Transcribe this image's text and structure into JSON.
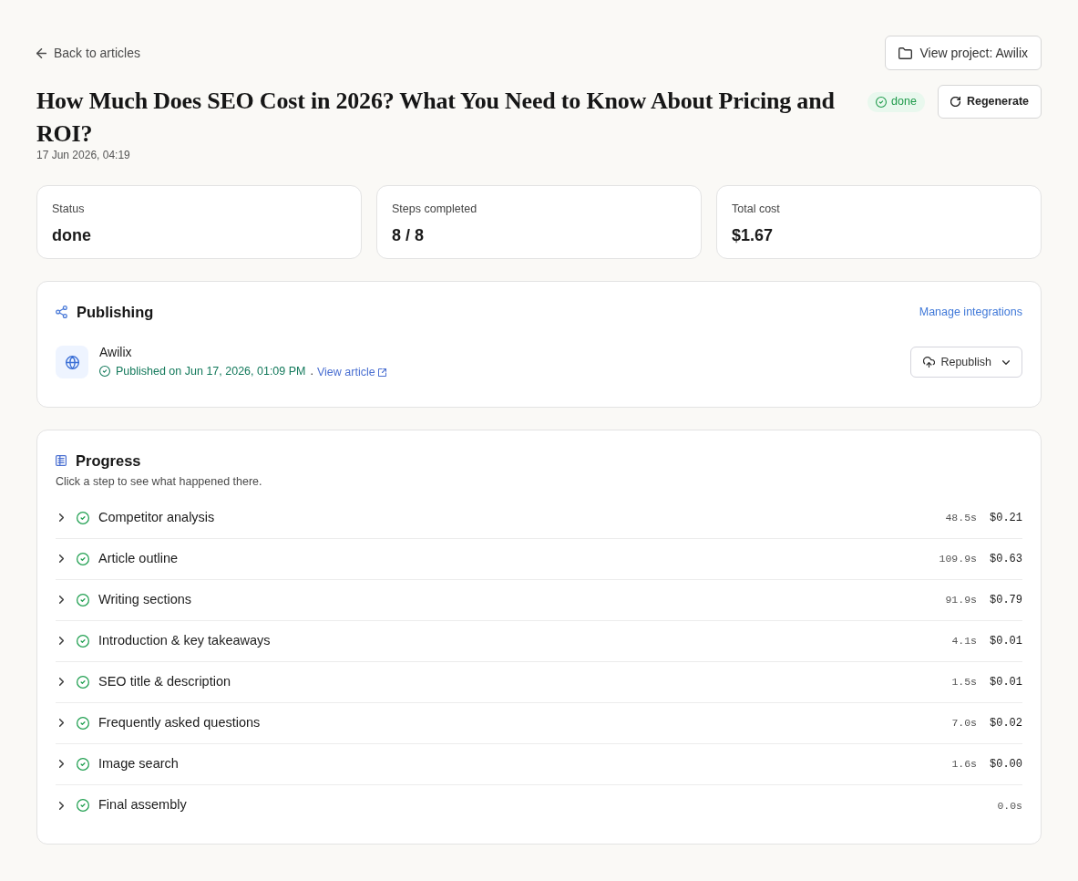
{
  "nav": {
    "back_link": "Back to articles",
    "project_button": "View project: Awilix"
  },
  "article": {
    "title": "How Much Does SEO Cost in 2026? What You Need to Know About Pricing and ROI?",
    "date": "17 Jun 2026, 04:19",
    "status_badge": {
      "label": "done",
      "completed": true
    },
    "regenerate_button": "Regenerate"
  },
  "stats": [
    {
      "label": "Status",
      "value": "done"
    },
    {
      "label": "Steps completed",
      "value": "8 / 8"
    },
    {
      "label": "Total cost",
      "value": "$1.67"
    }
  ],
  "publishing": {
    "title": "Publishing",
    "manage_link": "Manage integrations",
    "integrations": [
      {
        "name": "Awilix",
        "published": true,
        "status_text": "Published on Jun 17, 2026, 01:09 PM",
        "separator": ".",
        "view_link": "View article",
        "republish_button": "Republish"
      }
    ]
  },
  "progress": {
    "title": "Progress",
    "subtitle": "Click a step to see what happened there.",
    "steps": [
      {
        "label": "Competitor analysis",
        "completed": true,
        "expanded": false,
        "duration": "48.5s",
        "cost": "$0.21"
      },
      {
        "label": "Article outline",
        "completed": true,
        "expanded": false,
        "duration": "109.9s",
        "cost": "$0.63"
      },
      {
        "label": "Writing sections",
        "completed": true,
        "expanded": false,
        "duration": "91.9s",
        "cost": "$0.79"
      },
      {
        "label": "Introduction & key takeaways",
        "completed": true,
        "expanded": false,
        "duration": "4.1s",
        "cost": "$0.01"
      },
      {
        "label": "SEO title & description",
        "completed": true,
        "expanded": false,
        "duration": "1.5s",
        "cost": "$0.01"
      },
      {
        "label": "Frequently asked questions",
        "completed": true,
        "expanded": false,
        "duration": "7.0s",
        "cost": "$0.02"
      },
      {
        "label": "Image search",
        "completed": true,
        "expanded": false,
        "duration": "1.6s",
        "cost": "$0.00"
      },
      {
        "label": "Final assembly",
        "completed": true,
        "expanded": false,
        "duration": "0.0s"
      }
    ]
  }
}
